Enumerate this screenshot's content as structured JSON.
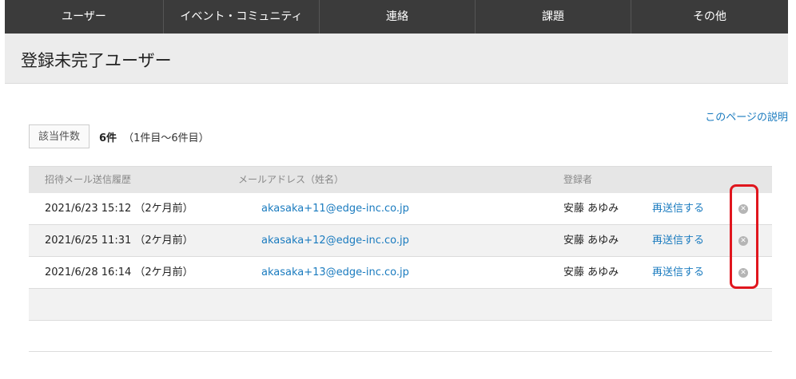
{
  "nav": {
    "items": [
      {
        "label": "ユーザー"
      },
      {
        "label": "イベント・コミュニティ"
      },
      {
        "label": "連絡"
      },
      {
        "label": "課題"
      },
      {
        "label": "その他"
      }
    ]
  },
  "page": {
    "title": "登録未完了ユーザー"
  },
  "help_link": "このページの説明",
  "count": {
    "label": "該当件数",
    "number": "6件",
    "range": "（1件目〜6件目）"
  },
  "table": {
    "headers": {
      "sent": "招待メール送信履歴",
      "email": "メールアドレス（姓名）",
      "registrant": "登録者"
    },
    "rows": [
      {
        "sent": "2021/6/23 15:12 （2ケ月前）",
        "email": "akasaka+11@edge-inc.co.jp",
        "registrant": "安藤 あゆみ",
        "resend": "再送信する"
      },
      {
        "sent": "2021/6/25 11:31 （2ケ月前）",
        "email": "akasaka+12@edge-inc.co.jp",
        "registrant": "安藤 あゆみ",
        "resend": "再送信する"
      },
      {
        "sent": "2021/6/28 16:14 （2ケ月前）",
        "email": "akasaka+13@edge-inc.co.jp",
        "registrant": "安藤 あゆみ",
        "resend": "再送信する"
      }
    ]
  },
  "icons": {
    "delete": "close-circle-icon"
  },
  "colors": {
    "nav_bg": "#3b3b3b",
    "link": "#1a7bbf",
    "highlight": "#e0161e"
  }
}
